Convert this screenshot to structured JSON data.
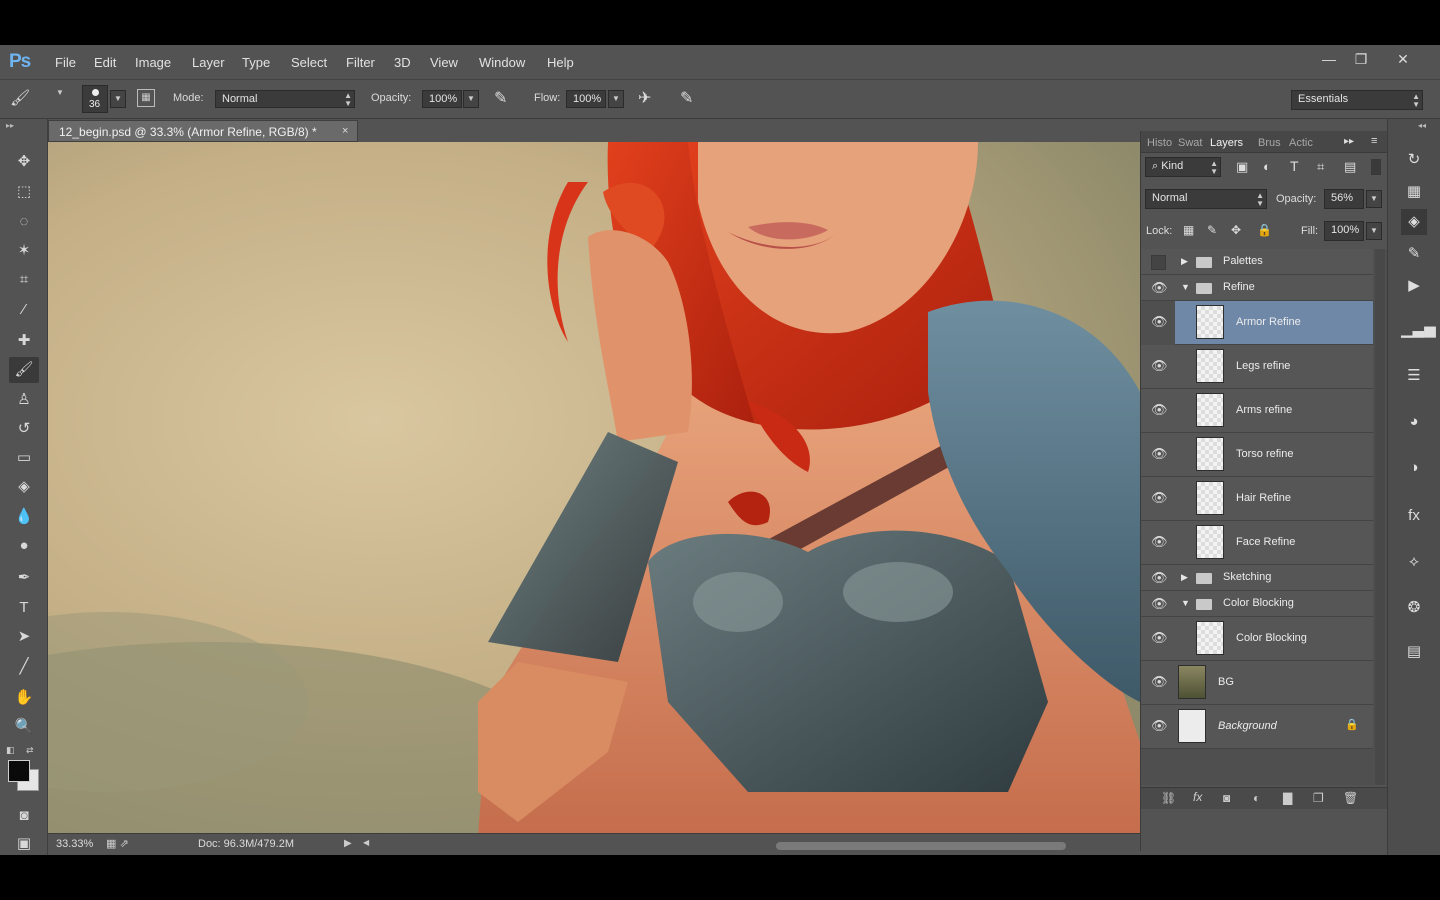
{
  "app": {
    "logo": "Ps",
    "menu": [
      "File",
      "Edit",
      "Image",
      "Layer",
      "Type",
      "Select",
      "Filter",
      "3D",
      "View",
      "Window",
      "Help"
    ],
    "window_controls": {
      "minimize": "—",
      "restore": "❐",
      "close": "✕"
    }
  },
  "options_bar": {
    "brush_size": "36",
    "mode_label": "Mode:",
    "mode_value": "Normal",
    "opacity_label": "Opacity:",
    "opacity_value": "100%",
    "flow_label": "Flow:",
    "flow_value": "100%",
    "workspace": "Essentials"
  },
  "document": {
    "tab_title": "12_begin.psd @ 33.3% (Armor Refine, RGB/8) *",
    "close": "×",
    "zoom": "33.33%",
    "doc_size": "Doc: 96.3M/479.2M"
  },
  "panel": {
    "tabs": [
      "Histo",
      "Swat",
      "Layers",
      "Brus",
      "Actic"
    ],
    "kind_filter": "Kind",
    "blend_mode": "Normal",
    "opacity_label": "Opacity:",
    "opacity_value": "56%",
    "lock_label": "Lock:",
    "fill_label": "Fill:",
    "fill_value": "100%",
    "layers": [
      {
        "name": "Palettes",
        "type": "group",
        "visible": false,
        "expanded": false
      },
      {
        "name": "Refine",
        "type": "group",
        "visible": true,
        "expanded": true
      },
      {
        "name": "Armor Refine",
        "type": "layer",
        "visible": true,
        "selected": true
      },
      {
        "name": "Legs refine",
        "type": "layer",
        "visible": true
      },
      {
        "name": "Arms refine",
        "type": "layer",
        "visible": true
      },
      {
        "name": "Torso refine",
        "type": "layer",
        "visible": true
      },
      {
        "name": "Hair Refine",
        "type": "layer",
        "visible": true
      },
      {
        "name": "Face Refine",
        "type": "layer",
        "visible": true
      },
      {
        "name": "Sketching",
        "type": "group",
        "visible": true,
        "expanded": false
      },
      {
        "name": "Color Blocking",
        "type": "group",
        "visible": true,
        "expanded": true
      },
      {
        "name": "Color Blocking",
        "type": "layer",
        "visible": true
      },
      {
        "name": "BG",
        "type": "layer",
        "visible": true
      },
      {
        "name": "Background",
        "type": "layer",
        "visible": true,
        "locked": true
      }
    ]
  }
}
